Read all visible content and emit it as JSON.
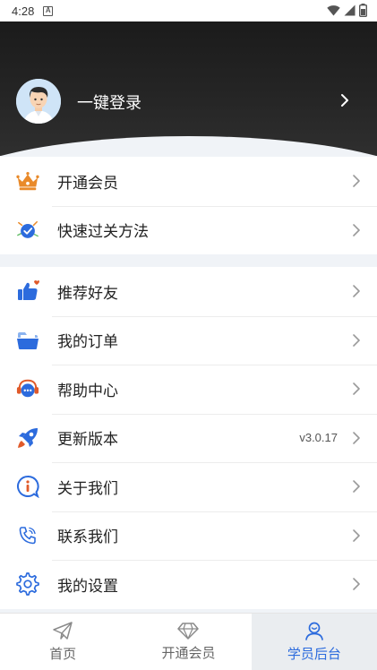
{
  "status_bar": {
    "time": "4:28",
    "notification_glyph": "A"
  },
  "header": {
    "login_label": "一键登录"
  },
  "section1": [
    {
      "label": "开通会员",
      "icon": "crown-icon"
    },
    {
      "label": "快速过关方法",
      "icon": "checkmark-badge-icon"
    }
  ],
  "section2": [
    {
      "label": "推荐好友",
      "icon": "thumbs-up-icon"
    },
    {
      "label": "我的订单",
      "icon": "folder-icon"
    },
    {
      "label": "帮助中心",
      "icon": "headset-chat-icon"
    },
    {
      "label": "更新版本",
      "icon": "rocket-icon",
      "value": "v3.0.17"
    },
    {
      "label": "关于我们",
      "icon": "info-bubble-icon"
    },
    {
      "label": "联系我们",
      "icon": "phone-icon"
    },
    {
      "label": "我的设置",
      "icon": "gear-icon"
    }
  ],
  "tabbar": {
    "tabs": [
      {
        "label": "首页",
        "icon": "paper-plane-icon"
      },
      {
        "label": "开通会员",
        "icon": "diamond-icon"
      },
      {
        "label": "学员后台",
        "icon": "student-icon",
        "active": true
      }
    ]
  },
  "colors": {
    "accent": "#2c6bdd",
    "header_dark": "#1b1b1b",
    "crown_orange": "#e98a2a",
    "background": "#f0f3f7"
  }
}
